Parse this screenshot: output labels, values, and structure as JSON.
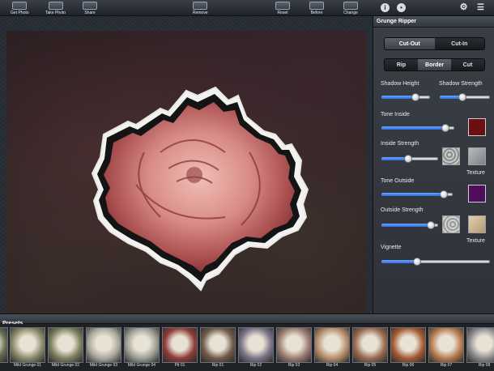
{
  "toolbar": {
    "get_photo": "Get Photo",
    "take_photo": "Take Photo",
    "share": "Share",
    "remove": "Remove",
    "reset": "Reset",
    "before": "Before",
    "change": "Change"
  },
  "panel": {
    "title": "Grunge Ripper",
    "mode_segments": [
      "Cut-Out",
      "Cut-In"
    ],
    "mode_active": "Cut-Out",
    "edge_segments": [
      "Rip",
      "Border",
      "Cut"
    ],
    "edge_active": "Border",
    "shadow_height_label": "Shadow Height",
    "shadow_height_value": 0.7,
    "shadow_strength_label": "Shadow Strength",
    "shadow_strength_value": 0.45,
    "tone_inside_label": "Tone Inside",
    "tone_inside_value": 0.88,
    "tone_inside_color": "#6b0f10",
    "inside_strength_label": "Inside Strength",
    "inside_strength_value": 0.47,
    "inside_texture_label": "Texture",
    "tone_outside_label": "Tone Outside",
    "tone_outside_value": 0.87,
    "tone_outside_color": "#4f0d5c",
    "outside_strength_label": "Outside Strength",
    "outside_strength_value": 0.87,
    "outside_texture_label": "Texture",
    "vignette_label": "Vignette",
    "vignette_value": 0.33
  },
  "presets": {
    "title": "Presets",
    "items": [
      {
        "label": "",
        "color": "#6a6f56"
      },
      {
        "label": "Mild Grunge 01",
        "color": "#8a8a6a"
      },
      {
        "label": "Mild Grunge 02",
        "color": "#7c7f5f"
      },
      {
        "label": "Mild Grunge 03",
        "color": "#a8a79c"
      },
      {
        "label": "Mild Grunge 04",
        "color": "#9c9d94"
      },
      {
        "label": "Pit 01",
        "color": "#8e3b37"
      },
      {
        "label": "Rip 01",
        "color": "#6f5a4a"
      },
      {
        "label": "Rip 02",
        "color": "#7b7487"
      },
      {
        "label": "Rip 03",
        "color": "#9b7c71"
      },
      {
        "label": "Rip 04",
        "color": "#b58d6a"
      },
      {
        "label": "Rip 05",
        "color": "#9a6a52"
      },
      {
        "label": "Rip 06",
        "color": "#a45a34"
      },
      {
        "label": "Rip 07",
        "color": "#b67a4e"
      },
      {
        "label": "Rip 08",
        "color": "#8c8a8e"
      }
    ]
  }
}
